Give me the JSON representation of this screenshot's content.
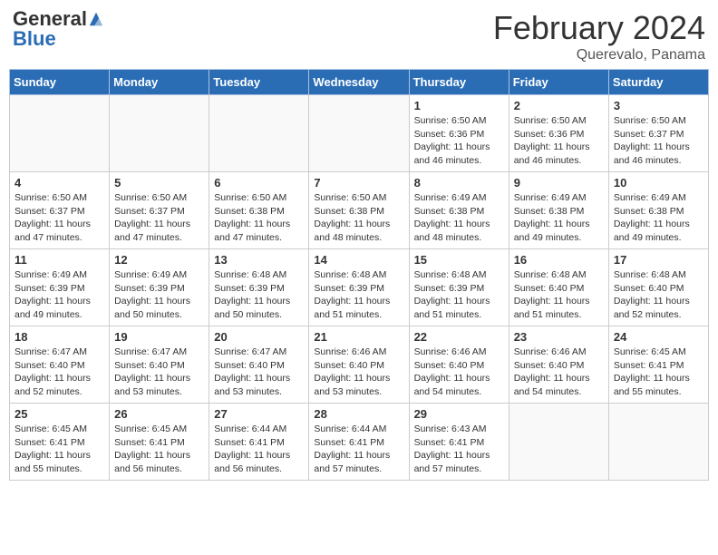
{
  "header": {
    "logo": {
      "general": "General",
      "blue": "Blue"
    },
    "title": "February 2024",
    "subtitle": "Querevalo, Panama"
  },
  "days_of_week": [
    "Sunday",
    "Monday",
    "Tuesday",
    "Wednesday",
    "Thursday",
    "Friday",
    "Saturday"
  ],
  "weeks": [
    [
      {
        "day": "",
        "info": ""
      },
      {
        "day": "",
        "info": ""
      },
      {
        "day": "",
        "info": ""
      },
      {
        "day": "",
        "info": ""
      },
      {
        "day": "1",
        "info": "Sunrise: 6:50 AM\nSunset: 6:36 PM\nDaylight: 11 hours\nand 46 minutes."
      },
      {
        "day": "2",
        "info": "Sunrise: 6:50 AM\nSunset: 6:36 PM\nDaylight: 11 hours\nand 46 minutes."
      },
      {
        "day": "3",
        "info": "Sunrise: 6:50 AM\nSunset: 6:37 PM\nDaylight: 11 hours\nand 46 minutes."
      }
    ],
    [
      {
        "day": "4",
        "info": "Sunrise: 6:50 AM\nSunset: 6:37 PM\nDaylight: 11 hours\nand 47 minutes."
      },
      {
        "day": "5",
        "info": "Sunrise: 6:50 AM\nSunset: 6:37 PM\nDaylight: 11 hours\nand 47 minutes."
      },
      {
        "day": "6",
        "info": "Sunrise: 6:50 AM\nSunset: 6:38 PM\nDaylight: 11 hours\nand 47 minutes."
      },
      {
        "day": "7",
        "info": "Sunrise: 6:50 AM\nSunset: 6:38 PM\nDaylight: 11 hours\nand 48 minutes."
      },
      {
        "day": "8",
        "info": "Sunrise: 6:49 AM\nSunset: 6:38 PM\nDaylight: 11 hours\nand 48 minutes."
      },
      {
        "day": "9",
        "info": "Sunrise: 6:49 AM\nSunset: 6:38 PM\nDaylight: 11 hours\nand 49 minutes."
      },
      {
        "day": "10",
        "info": "Sunrise: 6:49 AM\nSunset: 6:38 PM\nDaylight: 11 hours\nand 49 minutes."
      }
    ],
    [
      {
        "day": "11",
        "info": "Sunrise: 6:49 AM\nSunset: 6:39 PM\nDaylight: 11 hours\nand 49 minutes."
      },
      {
        "day": "12",
        "info": "Sunrise: 6:49 AM\nSunset: 6:39 PM\nDaylight: 11 hours\nand 50 minutes."
      },
      {
        "day": "13",
        "info": "Sunrise: 6:48 AM\nSunset: 6:39 PM\nDaylight: 11 hours\nand 50 minutes."
      },
      {
        "day": "14",
        "info": "Sunrise: 6:48 AM\nSunset: 6:39 PM\nDaylight: 11 hours\nand 51 minutes."
      },
      {
        "day": "15",
        "info": "Sunrise: 6:48 AM\nSunset: 6:39 PM\nDaylight: 11 hours\nand 51 minutes."
      },
      {
        "day": "16",
        "info": "Sunrise: 6:48 AM\nSunset: 6:40 PM\nDaylight: 11 hours\nand 51 minutes."
      },
      {
        "day": "17",
        "info": "Sunrise: 6:48 AM\nSunset: 6:40 PM\nDaylight: 11 hours\nand 52 minutes."
      }
    ],
    [
      {
        "day": "18",
        "info": "Sunrise: 6:47 AM\nSunset: 6:40 PM\nDaylight: 11 hours\nand 52 minutes."
      },
      {
        "day": "19",
        "info": "Sunrise: 6:47 AM\nSunset: 6:40 PM\nDaylight: 11 hours\nand 53 minutes."
      },
      {
        "day": "20",
        "info": "Sunrise: 6:47 AM\nSunset: 6:40 PM\nDaylight: 11 hours\nand 53 minutes."
      },
      {
        "day": "21",
        "info": "Sunrise: 6:46 AM\nSunset: 6:40 PM\nDaylight: 11 hours\nand 53 minutes."
      },
      {
        "day": "22",
        "info": "Sunrise: 6:46 AM\nSunset: 6:40 PM\nDaylight: 11 hours\nand 54 minutes."
      },
      {
        "day": "23",
        "info": "Sunrise: 6:46 AM\nSunset: 6:40 PM\nDaylight: 11 hours\nand 54 minutes."
      },
      {
        "day": "24",
        "info": "Sunrise: 6:45 AM\nSunset: 6:41 PM\nDaylight: 11 hours\nand 55 minutes."
      }
    ],
    [
      {
        "day": "25",
        "info": "Sunrise: 6:45 AM\nSunset: 6:41 PM\nDaylight: 11 hours\nand 55 minutes."
      },
      {
        "day": "26",
        "info": "Sunrise: 6:45 AM\nSunset: 6:41 PM\nDaylight: 11 hours\nand 56 minutes."
      },
      {
        "day": "27",
        "info": "Sunrise: 6:44 AM\nSunset: 6:41 PM\nDaylight: 11 hours\nand 56 minutes."
      },
      {
        "day": "28",
        "info": "Sunrise: 6:44 AM\nSunset: 6:41 PM\nDaylight: 11 hours\nand 57 minutes."
      },
      {
        "day": "29",
        "info": "Sunrise: 6:43 AM\nSunset: 6:41 PM\nDaylight: 11 hours\nand 57 minutes."
      },
      {
        "day": "",
        "info": ""
      },
      {
        "day": "",
        "info": ""
      }
    ]
  ]
}
